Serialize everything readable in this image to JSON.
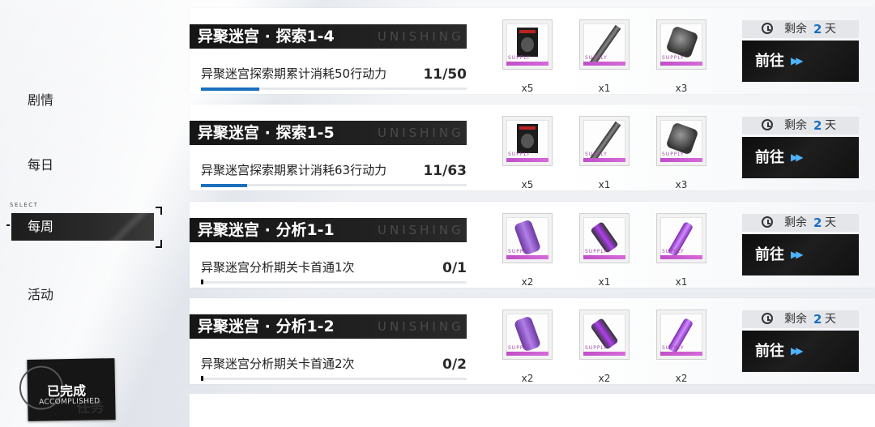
{
  "sidebar": {
    "select_tag": "SELECT",
    "items": [
      {
        "label": "剧情"
      },
      {
        "label": "每日"
      },
      {
        "label": "每周"
      },
      {
        "label": "活动"
      }
    ]
  },
  "accomplished_badge": {
    "main": "已完成",
    "sub": "ACCOMPLISHED",
    "ghost": "任务"
  },
  "tasks": [
    {
      "title": "异聚迷宫 · 探索1-4",
      "watermark": "UNISHING",
      "desc": "异聚迷宫探索期累计消耗50行动力",
      "count": "11/50",
      "progress": 0.22,
      "rewards": [
        {
          "icon": "book-item-icon",
          "qty": "x5"
        },
        {
          "icon": "rod-item-icon",
          "qty": "x1"
        },
        {
          "icon": "metal-item-icon",
          "qty": "x3"
        }
      ],
      "days_label": "剩余",
      "days_value": "2",
      "days_unit": "天",
      "go_label": "前往",
      "go_arrows": "▶▶"
    },
    {
      "title": "异聚迷宫 · 探索1-5",
      "watermark": "UNISHING",
      "desc": "异聚迷宫探索期累计消耗63行动力",
      "count": "11/63",
      "progress": 0.175,
      "rewards": [
        {
          "icon": "book-item-icon",
          "qty": "x5"
        },
        {
          "icon": "rod-item-icon",
          "qty": "x1"
        },
        {
          "icon": "metal-item-icon",
          "qty": "x3"
        }
      ],
      "days_label": "剩余",
      "days_value": "2",
      "days_unit": "天",
      "go_label": "前往",
      "go_arrows": "▶▶"
    },
    {
      "title": "异聚迷宫 · 分析1-1",
      "watermark": "UNISHING",
      "desc": "异聚迷宫分析期关卡首通1次",
      "count": "0/1",
      "progress": 0,
      "rewards": [
        {
          "icon": "canister-item-icon",
          "qty": "x2"
        },
        {
          "icon": "flask-item-icon",
          "qty": "x1"
        },
        {
          "icon": "tube-item-icon",
          "qty": "x1"
        }
      ],
      "days_label": "剩余",
      "days_value": "2",
      "days_unit": "天",
      "go_label": "前往",
      "go_arrows": "▶▶"
    },
    {
      "title": "异聚迷宫 · 分析1-2",
      "watermark": "UNISHING",
      "desc": "异聚迷宫分析期关卡首通2次",
      "count": "0/2",
      "progress": 0,
      "rewards": [
        {
          "icon": "canister-item-icon",
          "qty": "x2"
        },
        {
          "icon": "flask-item-icon",
          "qty": "x2"
        },
        {
          "icon": "tube-item-icon",
          "qty": "x2"
        }
      ],
      "days_label": "剩余",
      "days_value": "2",
      "days_unit": "天",
      "go_label": "前往",
      "go_arrows": "▶▶"
    }
  ],
  "supply_text": "SUPPLY",
  "colors": {
    "progress": "#1a6fbf",
    "rarity": "#c04fc8",
    "days_num": "#1a6fbf"
  }
}
